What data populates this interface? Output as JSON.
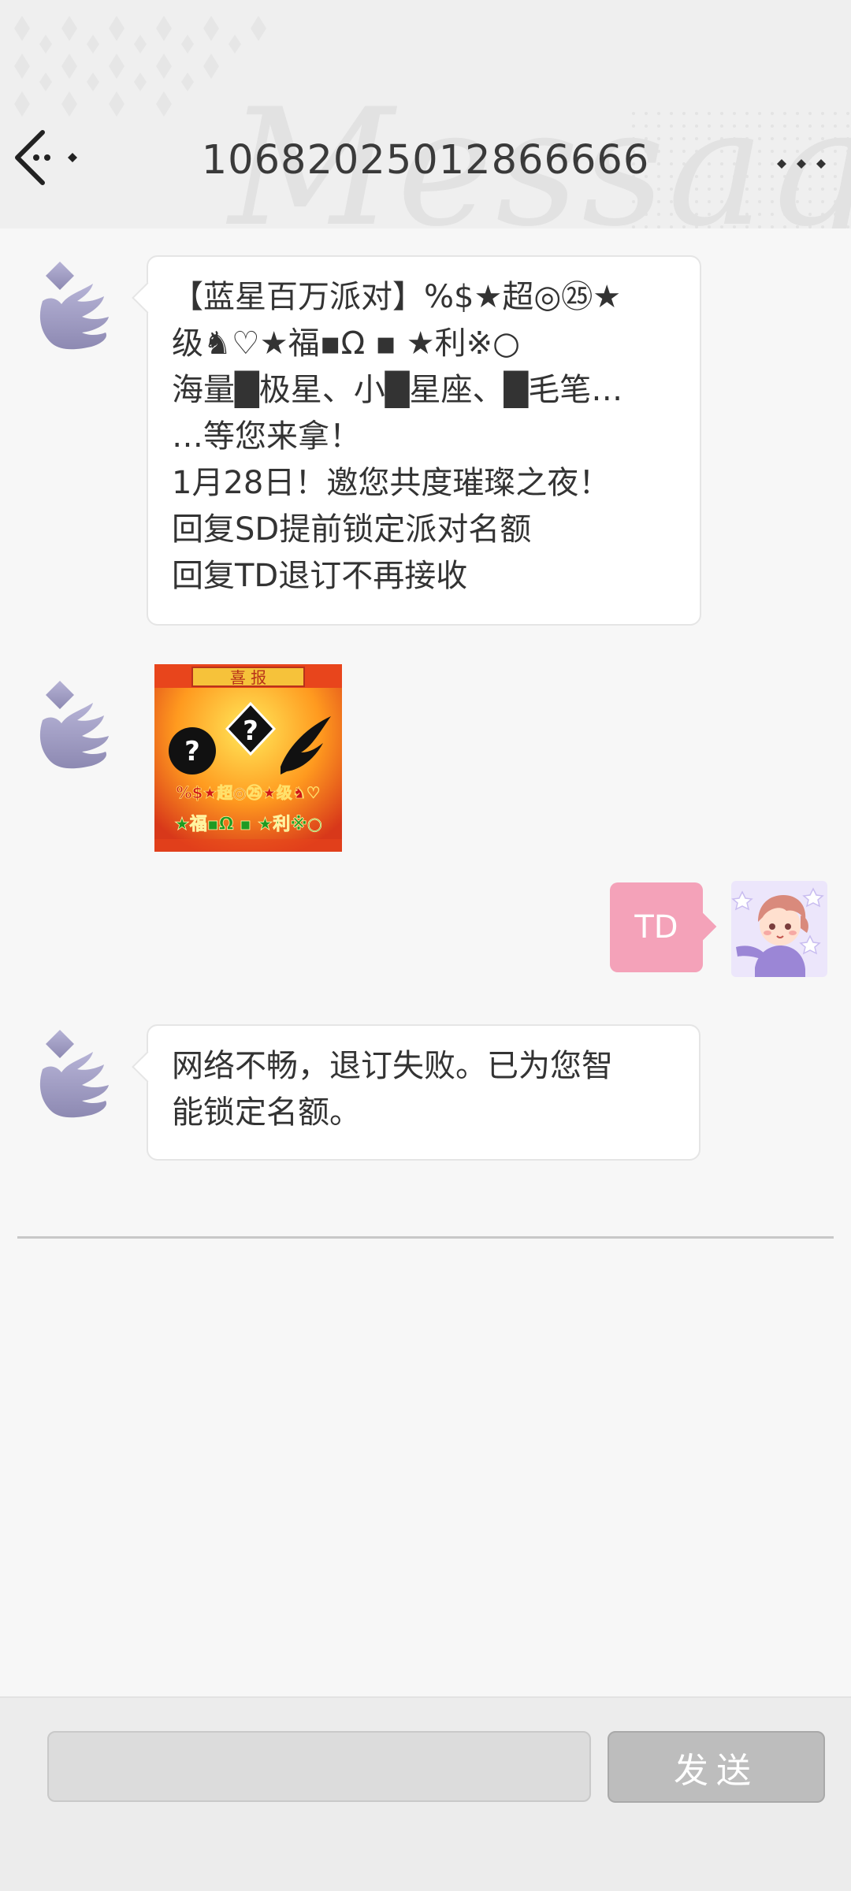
{
  "header": {
    "title": "10682025012866666",
    "watermark": "Message",
    "back_icon": "back-arrow-icon",
    "more_icon": "more-dots-icon"
  },
  "messages": [
    {
      "direction": "incoming",
      "type": "text",
      "lines": [
        "【蓝星百万派对】%$★超◎㉕★",
        "级♞♡★福▪Ω ▪ ★利※○",
        "海量█极星、小█星座、█毛笔…",
        "…等您来拿！",
        "1月28日！邀您共度璀璨之夜！",
        "回复SD提前锁定派对名额",
        "回复TD退订不再接收"
      ]
    },
    {
      "direction": "incoming",
      "type": "image",
      "image_text": {
        "banner": "喜 报",
        "row1": "%$★超◎㉕★级♞♡",
        "row2": "★福▪Ω ▪ ★利※○"
      }
    },
    {
      "direction": "outgoing",
      "type": "text",
      "text": "TD"
    },
    {
      "direction": "incoming",
      "type": "text",
      "lines": [
        "网络不畅，退订失败。已为您智",
        "能锁定名额。"
      ]
    }
  ],
  "composer": {
    "input_value": "",
    "input_placeholder": "",
    "send_label": "发送"
  },
  "colors": {
    "outgoing_bubble": "#f4a2b9",
    "send_button": "#bdbdbd",
    "avatar_icon": "#9a97bd"
  }
}
